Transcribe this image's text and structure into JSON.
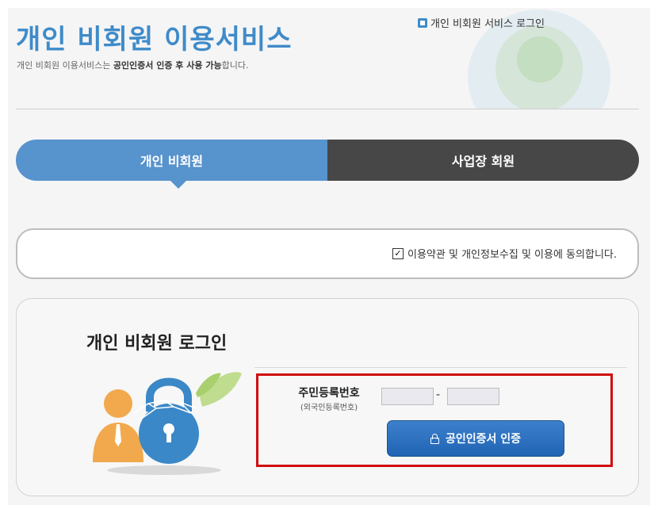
{
  "header": {
    "title": "개인 비회원 이용서비스",
    "subtitle_pre": "개인 비회원 이용서비스는 ",
    "subtitle_bold": "공인인증서 인증 후 사용 가능",
    "subtitle_post": "합니다.",
    "breadcrumb": "개인 비회원 서비스 로그인"
  },
  "tabs": [
    {
      "label": "개인 비회원",
      "active": true
    },
    {
      "label": "사업장 회원",
      "active": false
    }
  ],
  "agreement": {
    "label": "이용약관 및 개인정보수집 및 이용에 동의합니다.",
    "checked": true,
    "check_glyph": "✓"
  },
  "login": {
    "title": "개인 비회원 로그인",
    "field_label": "주민등록번호",
    "field_sublabel": "(외국인등록번호)",
    "rrn_front_value": "",
    "rrn_back_value": "",
    "separator": "-",
    "cert_button_label": "공인인증서 인증"
  },
  "icons": {
    "breadcrumb": "home-icon",
    "button": "lock-icon",
    "illustration": "person-lock-illustration"
  },
  "colors": {
    "title_blue": "#3f8bc9",
    "active_tab": "#5793cd",
    "inactive_tab": "#474747",
    "button_blue": "#2a6fbf",
    "highlight_red": "#d00d0d"
  }
}
